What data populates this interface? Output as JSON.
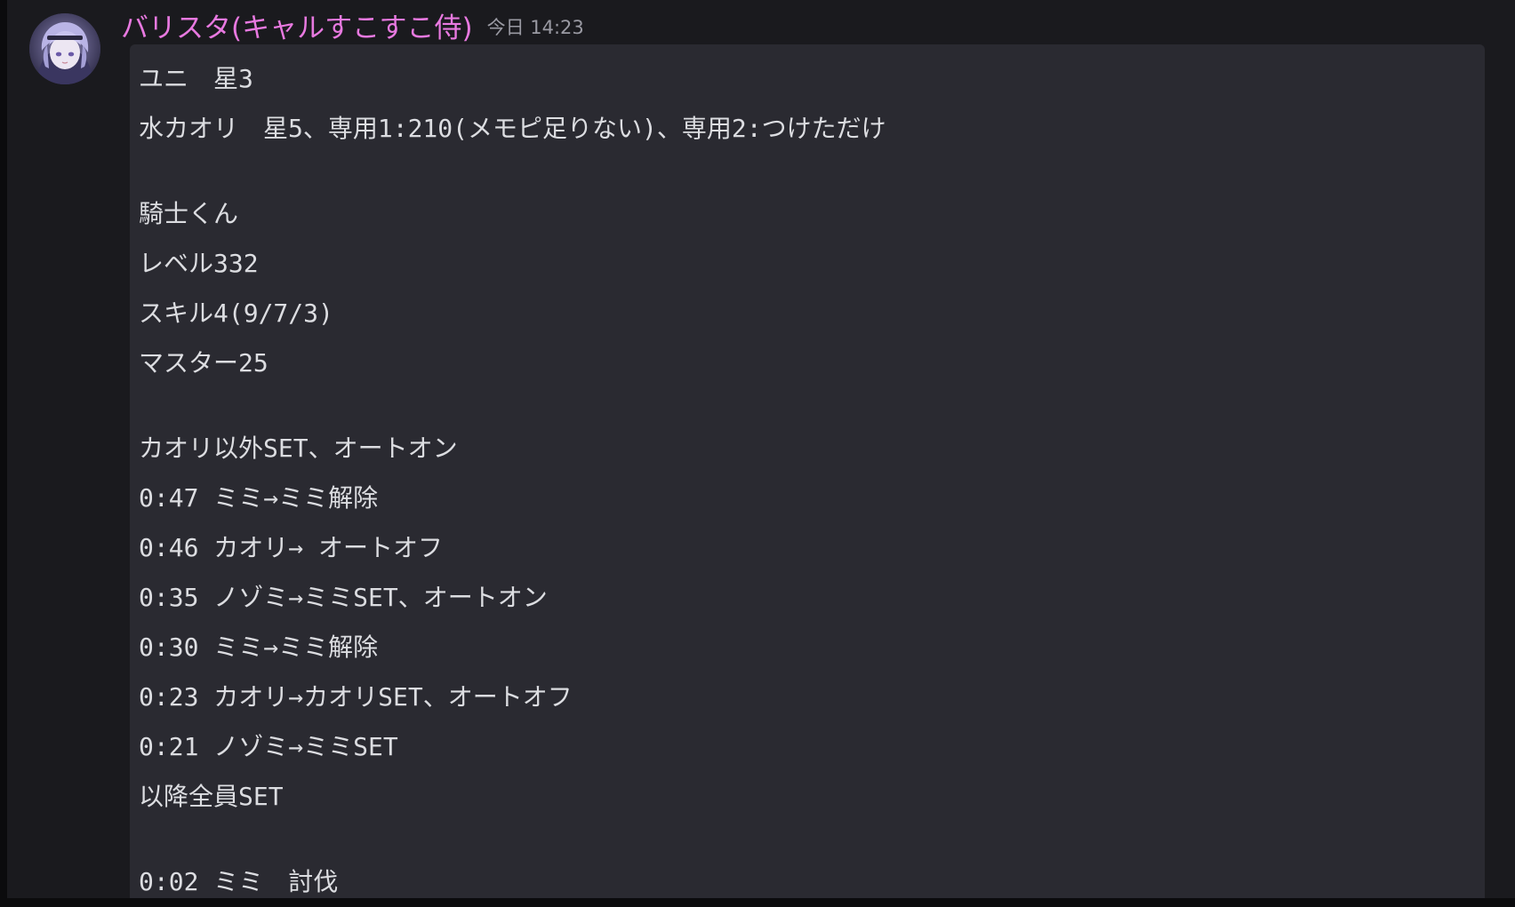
{
  "message": {
    "username": "バリスタ(キャルすこすこ侍)",
    "timestamp": "今日 14:23",
    "colors": {
      "username": "#e879e0",
      "timestamp": "#9a9aa3",
      "code_background": "#2a2a31",
      "pane_background": "#1a1a1e"
    },
    "avatar_icon": "anime-character-avatar",
    "code_lines": [
      "ユニ　星3",
      "水カオリ　星5、専用1:210(メモピ足りない)、専用2:つけただけ",
      "",
      "騎士くん",
      "レベル332",
      "スキル4(9/7/3)",
      "マスター25",
      "",
      "カオリ以外SET、オートオン",
      "0:47 ミミ→ミミ解除",
      "0:46 カオリ→ オートオフ",
      "0:35 ノゾミ→ミミSET、オートオン",
      "0:30 ミミ→ミミ解除",
      "0:23 カオリ→カオリSET、オートオフ",
      "0:21 ノゾミ→ミミSET",
      "以降全員SET",
      "",
      "0:02 ミミ　討伐"
    ]
  }
}
